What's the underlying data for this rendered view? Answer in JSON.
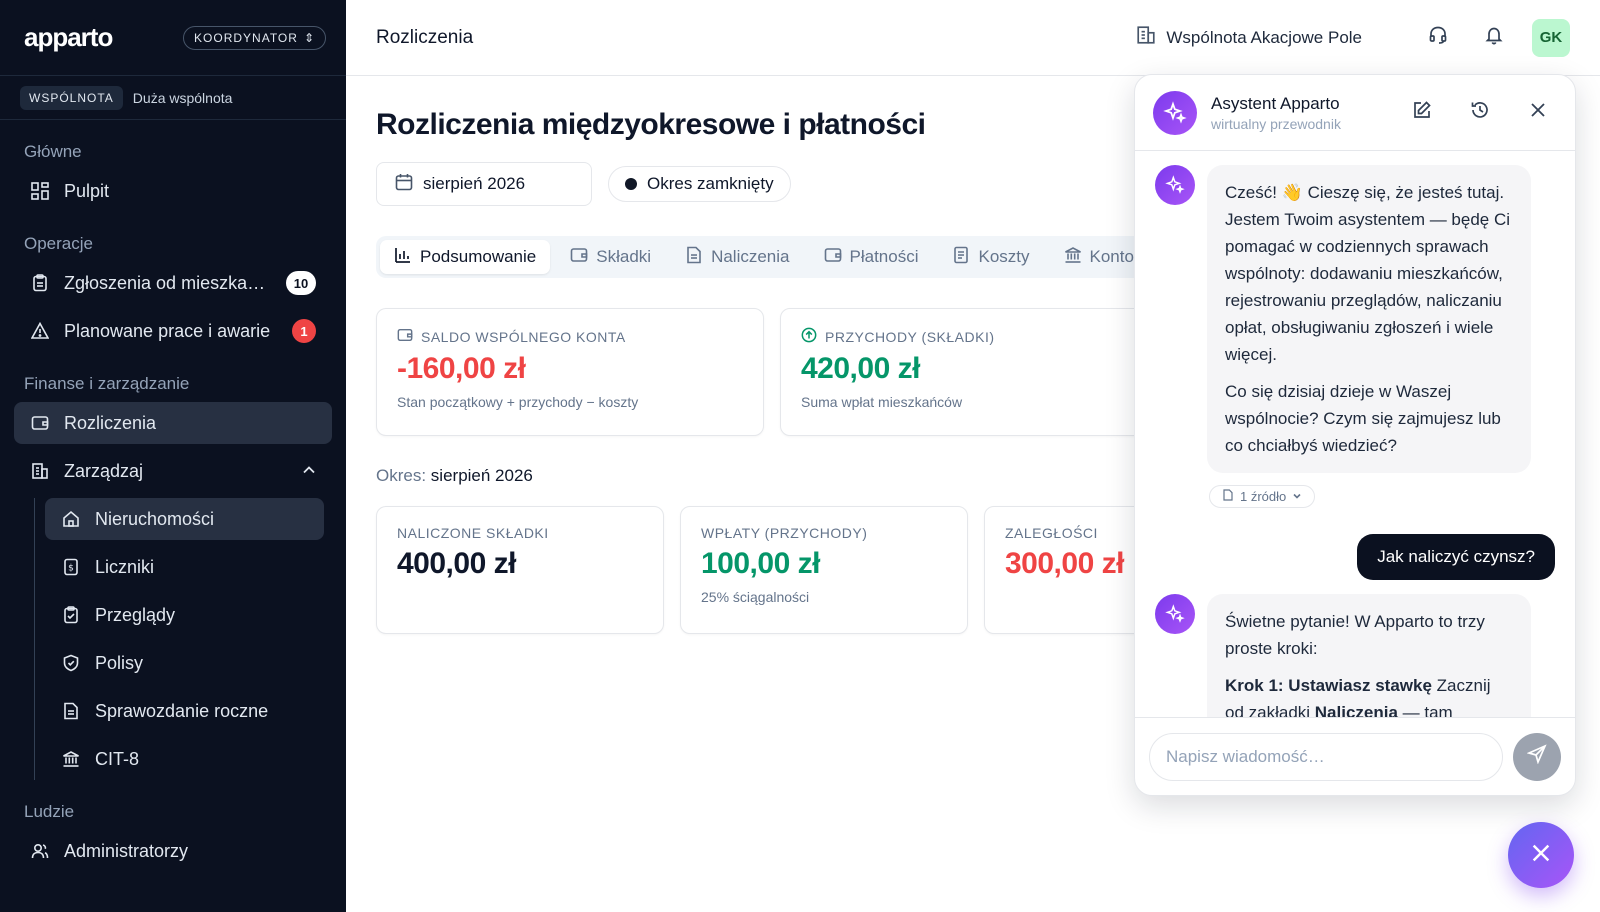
{
  "sidebar": {
    "logo": "apparto",
    "role": "KOORDYNATOR",
    "community_type": "WSPÓLNOTA",
    "community_name": "Duża wspólnota",
    "sections": {
      "main": "Główne",
      "operations": "Operacje",
      "finance": "Finanse i zarządzanie",
      "people": "Ludzie"
    },
    "items": {
      "dashboard": "Pulpit",
      "requests": "Zgłoszenia od mieszkań…",
      "requests_count": "10",
      "works": "Planowane prace i awarie",
      "works_count": "1",
      "settlements": "Rozliczenia",
      "manage": "Zarządzaj",
      "properties": "Nieruchomości",
      "meters": "Liczniki",
      "inspections": "Przeglądy",
      "policies": "Polisy",
      "annual_report": "Sprawozdanie roczne",
      "cit8": "CIT-8",
      "administrators": "Administratorzy"
    }
  },
  "topbar": {
    "title": "Rozliczenia",
    "community": "Wspólnota Akacjowe Pole",
    "avatar_initials": "GK"
  },
  "main": {
    "title": "Rozliczenia międzyokresowe i płatności",
    "date": "sierpień 2026",
    "status": "Okres zamknięty",
    "tabs": [
      "Podsumowanie",
      "Składki",
      "Naliczenia",
      "Płatności",
      "Koszty",
      "Konto"
    ],
    "cards_top": [
      {
        "label": "SALDO WSPÓLNEGO KONTA",
        "value": "-160,00 zł",
        "sub": "Stan początkowy + przychody − koszty"
      },
      {
        "label": "PRZYCHODY (SKŁADKI)",
        "value": "420,00 zł",
        "sub": "Suma wpłat mieszkańców"
      }
    ],
    "period_label": "Okres:",
    "period_value": "sierpień 2026",
    "cards_bottom": [
      {
        "label": "NALICZONE SKŁADKI",
        "value": "400,00 zł",
        "sub": ""
      },
      {
        "label": "WPŁATY (PRZYCHODY)",
        "value": "100,00 zł",
        "sub": "25% ściągalności"
      },
      {
        "label": "ZALEGŁOŚCI",
        "value": "300,00 zł",
        "sub": ""
      }
    ]
  },
  "assistant": {
    "name": "Asystent Apparto",
    "subtitle": "wirtualny przewodnik",
    "msg1_p1": "Cześć! 👋 Cieszę się, że jesteś tutaj. Jestem Twoim asystentem — będę Ci pomagać w codziennych sprawach wspólnoty: dodawaniu mieszkańców, rejestrowaniu przeglądów, naliczaniu opłat, obsługiwaniu zgłoszeń i wiele więcej.",
    "msg1_p2": "Co się dzisiaj dzieje w Waszej wspólnocie? Czym się zajmujesz lub co chciałbyś wiedzieć?",
    "source": "1 źródło",
    "user_msg": "Jak naliczyć czynsz?",
    "msg2_p1": "Świetne pytanie! W Apparto to trzy proste kroki:",
    "msg2_step_bold": "Krok 1: Ustawiasz stawkę",
    "msg2_step_text": " Zacznij od zakładki ",
    "msg2_step_bold2": "Naliczenia",
    "msg2_step_text2": " — tam definiujesz, ile kaźdy",
    "input_placeholder": "Napisz wiadomość…"
  }
}
